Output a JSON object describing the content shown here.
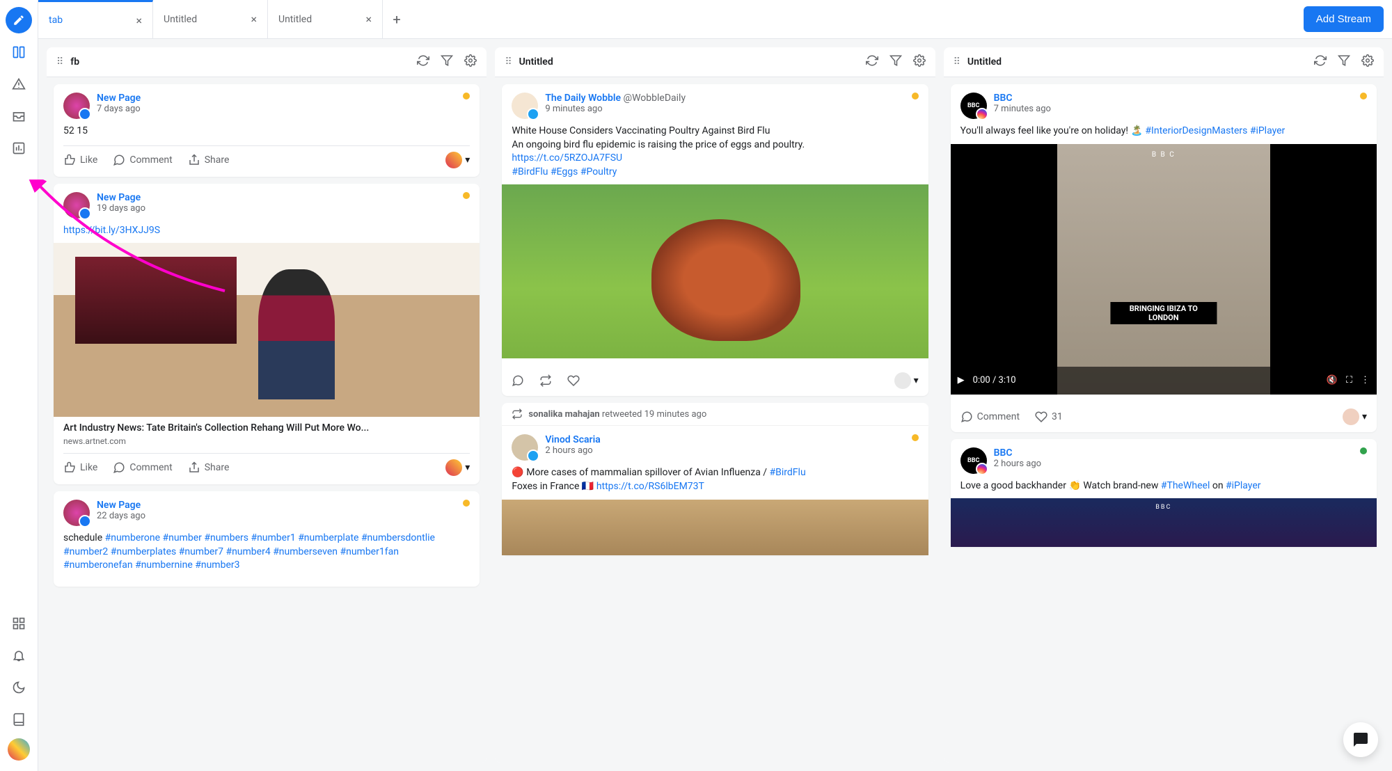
{
  "tabs": [
    {
      "label": "tab",
      "active": true
    },
    {
      "label": "Untitled",
      "active": false
    },
    {
      "label": "Untitled",
      "active": false
    }
  ],
  "addStreamLabel": "Add Stream",
  "streams": [
    {
      "title": "fb",
      "posts": [
        {
          "author": "New Page",
          "network": "fb",
          "time": "7 days ago",
          "status": "orange",
          "text": "52 15",
          "actions": {
            "like": "Like",
            "comment": "Comment",
            "share": "Share"
          }
        },
        {
          "author": "New Page",
          "network": "fb",
          "time": "19 days ago",
          "status": "orange",
          "link": "https://bit.ly/3HXJJ9S",
          "image": "gallery",
          "article": {
            "title": "Art Industry News: Tate Britain's Collection Rehang Will Put More Wo...",
            "domain": "news.artnet.com"
          },
          "actions": {
            "like": "Like",
            "comment": "Comment",
            "share": "Share"
          }
        },
        {
          "author": "New Page",
          "network": "fb",
          "time": "22 days ago",
          "status": "orange",
          "textPrefix": "schedule ",
          "hashtags": [
            "#numberone",
            "#number",
            "#numbers",
            "#number1",
            "#numberplate",
            "#numbersdontlie",
            "#number2",
            "#numberplates",
            "#number7",
            "#number4",
            "#numberseven",
            "#number1fan",
            "#numberonefan",
            "#numbernine",
            "#number3"
          ]
        }
      ]
    },
    {
      "title": "Untitled",
      "posts": [
        {
          "author": "The Daily Wobble",
          "handle": "@WobbleDaily",
          "network": "tw",
          "time": "9 minutes ago",
          "status": "orange",
          "lines": [
            "White House Considers Vaccinating Poultry Against Bird Flu",
            "An ongoing bird flu epidemic is raising the price of eggs and poultry."
          ],
          "link": "https://t.co/5RZOJA7FSU",
          "hashtags": [
            "#BirdFlu",
            "#Eggs",
            "#Poultry"
          ],
          "image": "chicken",
          "twActions": true
        },
        {
          "retweet": {
            "who": "sonalika mahajan",
            "verb": "retweeted",
            "time": "19 minutes ago"
          },
          "author": "Vinod Scaria",
          "network": "tw",
          "time": "2 hours ago",
          "status": "orange",
          "text": "🔴 More cases of mammalian spillover of Avian Influenza / ",
          "inlineHashtag": "#BirdFlu",
          "text2": "Foxes in France 🇫🇷 ",
          "link2": "https://t.co/RS6lbEM73T",
          "image": "foxes"
        }
      ]
    },
    {
      "title": "Untitled",
      "posts": [
        {
          "author": "BBC",
          "network": "ig",
          "time": "7 minutes ago",
          "status": "orange",
          "text": "You'll always feel like you're on holiday! 🏝️ ",
          "hashtags": [
            "#InteriorDesignMasters",
            "#iPlayer"
          ],
          "video": {
            "caption": "BRINGING IBIZA TO LONDON",
            "time": "0:00 / 3:10"
          },
          "igActions": {
            "comment": "Comment",
            "likes": "31"
          }
        },
        {
          "author": "BBC",
          "network": "ig",
          "time": "2 hours ago",
          "status": "green",
          "text": "Love a good backhander 👏 Watch brand-new ",
          "inlineHashtag": "#TheWheel",
          "text2": " on ",
          "inlineHashtag2": "#iPlayer",
          "image": "quiz"
        }
      ]
    }
  ]
}
